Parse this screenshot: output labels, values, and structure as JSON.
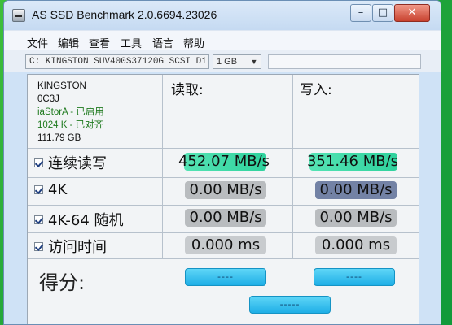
{
  "window": {
    "title": "AS SSD Benchmark 2.0.6694.23026",
    "controls": {
      "minimize": "–",
      "maximize": "□",
      "close": "✕"
    }
  },
  "menu": [
    "文件",
    "编辑",
    "查看",
    "工具",
    "语言",
    "帮助"
  ],
  "toolbar": {
    "drive_select": "C: KINGSTON SUV400S37120G SCSI Di",
    "size_select": "1 GB"
  },
  "drive_info": {
    "model": "KINGSTON",
    "firmware": "0C3J",
    "driver": "iaStorA - 已启用",
    "alignment": "1024 K - 已对齐",
    "capacity": "111.79 GB"
  },
  "columns": {
    "read": "读取:",
    "write": "写入:"
  },
  "rows": [
    {
      "label": "连续读写",
      "read": "452.07 MB/s",
      "write": "351.46 MB/s",
      "read_progress": 0.9,
      "write_progress": 0.93
    },
    {
      "label": "4K",
      "read": "0.00 MB/s",
      "write": "0.00 MB/s"
    },
    {
      "label": "4K-64 随机",
      "read": "0.00 MB/s",
      "write": "0.00 MB/s"
    },
    {
      "label": "访问时间",
      "read": "0.000 ms",
      "write": "0.000 ms"
    }
  ],
  "score": {
    "label": "得分:",
    "read": "----",
    "write": "----",
    "total": "-----"
  },
  "colors": {
    "accent": "#2fd29d",
    "score_button": "#1eaee6",
    "navy_value": "#7382a5"
  }
}
